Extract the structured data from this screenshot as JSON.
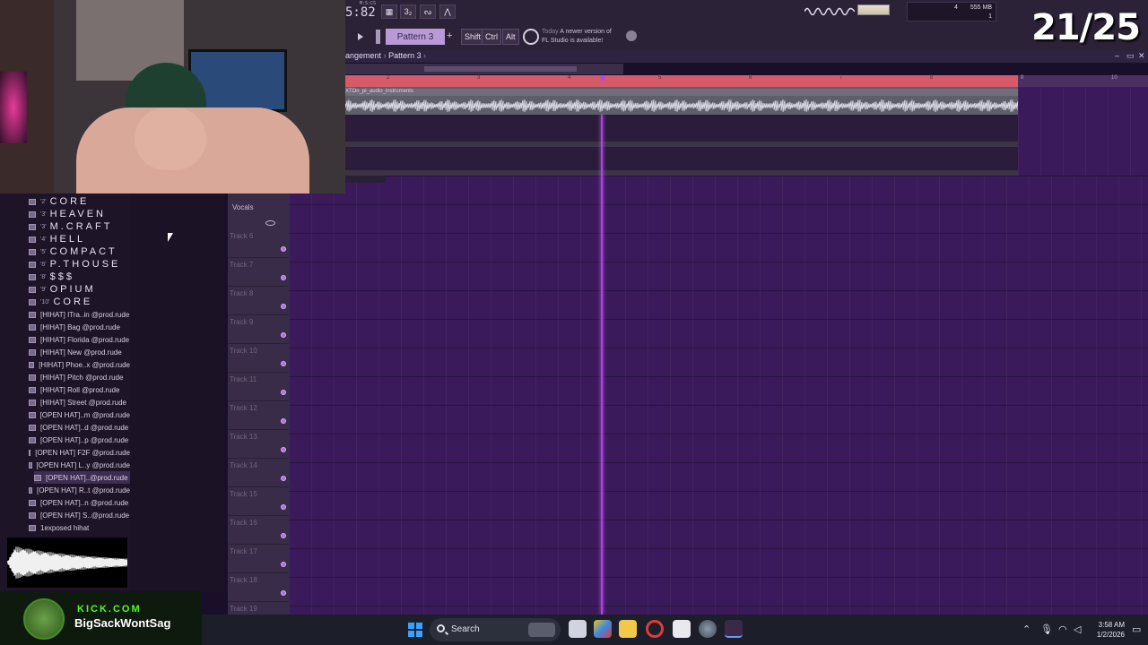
{
  "toolbar": {
    "time": "5:82",
    "time_unit": "M:S:CS",
    "step_edit_label": "3₂",
    "cpu_value": "4",
    "memory": "555 MB",
    "polyphony": "1",
    "pattern": "Pattern 3",
    "add_pattern": "+",
    "shift_label": "Shift",
    "ctrl_label": "Ctrl",
    "alt_label": "Alt",
    "news_day": "Today",
    "news_line1": "A newer version of",
    "news_line2": "FL Studio is available!"
  },
  "playlist": {
    "breadcrumb": [
      "angement",
      "Pattern 3"
    ],
    "clip_name": "XTOn_pl_audio_instruments",
    "ruler_numbers": [
      "2",
      "3",
      "4",
      "5",
      "6",
      "7",
      "8",
      "9",
      "10"
    ]
  },
  "tracks": {
    "vocals": "Vocals",
    "list": [
      "Track 6",
      "Track 7",
      "Track 8",
      "Track 9",
      "Track 10",
      "Track 11",
      "Track 12",
      "Track 13",
      "Track 14",
      "Track 15",
      "Track 16",
      "Track 17",
      "Track 18",
      "Track 19"
    ]
  },
  "browser": {
    "items": [
      {
        "prefix": "'2'",
        "label": "CORE",
        "big": true
      },
      {
        "prefix": "'3'",
        "label": "HEAVEN",
        "big": true
      },
      {
        "prefix": "'3'",
        "label": "M.CRAFT",
        "big": true
      },
      {
        "prefix": "'4'",
        "label": "HELL",
        "big": true
      },
      {
        "prefix": "'5'",
        "label": "COMPACT",
        "big": true
      },
      {
        "prefix": "'6'",
        "label": "P.THOUSE",
        "big": true
      },
      {
        "prefix": "'8'",
        "label": "$$$",
        "big": true
      },
      {
        "prefix": "'9'",
        "label": "OPIUM",
        "big": true
      },
      {
        "prefix": "'10'",
        "label": "CORE",
        "big": true
      },
      {
        "prefix": "",
        "label": "[HIHAT] ITra..in @prod.rude",
        "big": false
      },
      {
        "prefix": "",
        "label": "[HIHAT] Bag @prod.rude",
        "big": false
      },
      {
        "prefix": "",
        "label": "[HIHAT] Florida @prod.rude",
        "big": false
      },
      {
        "prefix": "",
        "label": "[HIHAT] New @prod.rude",
        "big": false
      },
      {
        "prefix": "",
        "label": "[HIHAT] Phoe..x @prod.rude",
        "big": false
      },
      {
        "prefix": "",
        "label": "[HIHAT] Pitch @prod.rude",
        "big": false
      },
      {
        "prefix": "",
        "label": "[HIHAT] Roll @prod.rude",
        "big": false
      },
      {
        "prefix": "",
        "label": "[HIHAT] Street @prod.rude",
        "big": false
      },
      {
        "prefix": "",
        "label": "[OPEN HAT]..m @prod.rude",
        "big": false
      },
      {
        "prefix": "",
        "label": "[OPEN HAT]..d @prod.rude",
        "big": false
      },
      {
        "prefix": "",
        "label": "[OPEN HAT]..p @prod.rude",
        "big": false
      },
      {
        "prefix": "",
        "label": "[OPEN HAT] F2F @prod.rude",
        "big": false
      },
      {
        "prefix": "",
        "label": "[OPEN HAT] L..y @prod.rude",
        "big": false
      },
      {
        "prefix": "",
        "label": "[OPEN HAT]..@prod.rude",
        "big": false,
        "selected": true
      },
      {
        "prefix": "",
        "label": "[OPEN HAT] R..t @prod.rude",
        "big": false
      },
      {
        "prefix": "",
        "label": "[OPEN HAT]..n @prod.rude",
        "big": false
      },
      {
        "prefix": "",
        "label": "[OPEN HAT] S..@prod.rude",
        "big": false
      },
      {
        "prefix": "",
        "label": "1exposed hihat",
        "big": false
      }
    ]
  },
  "overlay": {
    "counter": "21/25",
    "kick_domain": "KICK.COM",
    "kick_user": "BigSackWontSag"
  },
  "taskbar": {
    "search": "Search",
    "time": "3:58 AM",
    "date": "1/2/2026"
  }
}
